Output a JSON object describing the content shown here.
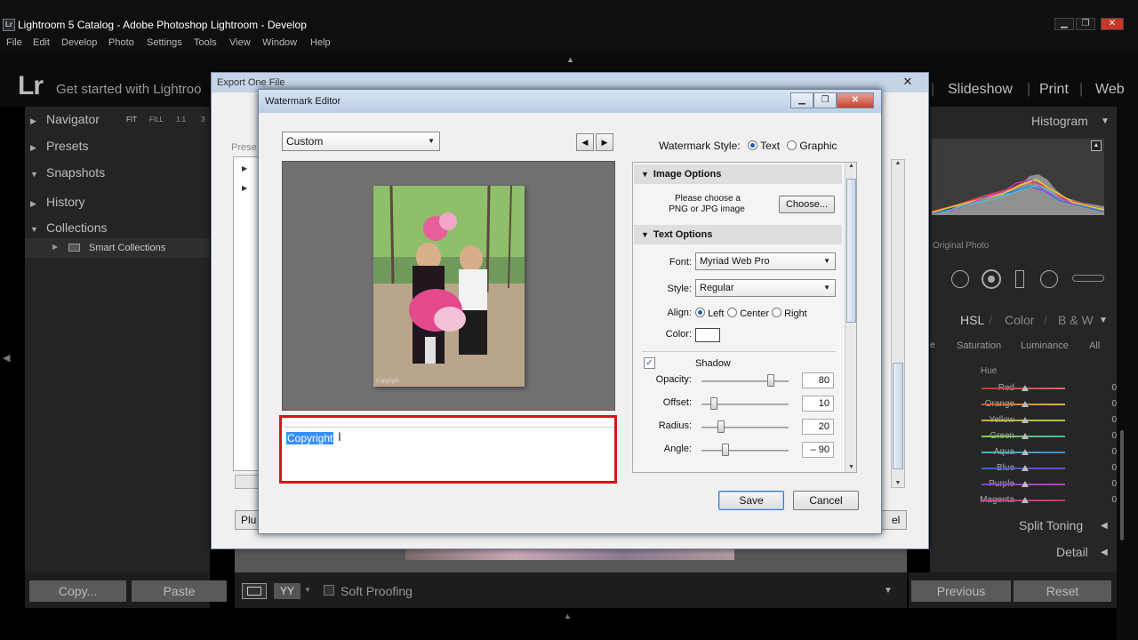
{
  "window": {
    "title": "Lightroom 5 Catalog - Adobe Photoshop Lightroom - Develop",
    "icon": "Lr"
  },
  "menu": [
    "File",
    "Edit",
    "Develop",
    "Photo",
    "Settings",
    "Tools",
    "View",
    "Window",
    "Help"
  ],
  "modulebar": {
    "logo": "Lr",
    "started": "Get started with Lightroo",
    "modules": [
      "Slideshow",
      "Print",
      "Web"
    ]
  },
  "left_panel": {
    "sections": [
      {
        "label": "Navigator",
        "expanded": false
      },
      {
        "label": "Presets",
        "expanded": false
      },
      {
        "label": "Snapshots",
        "expanded": true
      },
      {
        "label": "History",
        "expanded": false
      },
      {
        "label": "Collections",
        "expanded": true
      }
    ],
    "nav_zoom": [
      "FIT",
      "FILL",
      "1:1",
      "3"
    ],
    "smart_collections": "Smart Collections",
    "copy_btn": "Copy...",
    "paste_btn": "Paste"
  },
  "toolbar": {
    "soft_proofing": "Soft Proofing"
  },
  "right_panel": {
    "histogram": "Histogram",
    "original_photo": "Original Photo",
    "hsl_tabs": [
      "HSL",
      "Color",
      "B & W"
    ],
    "hsl_subtabs": [
      "Saturation",
      "Luminance",
      "All"
    ],
    "hue_label": "Hue",
    "hue_rows": [
      {
        "name": "Red",
        "value": "0",
        "color": "#d13c3c"
      },
      {
        "name": "Orange",
        "value": "0",
        "color": "#d98a2c"
      },
      {
        "name": "Yellow",
        "value": "0",
        "color": "#d6c93a"
      },
      {
        "name": "Green",
        "value": "0",
        "color": "#4aa84a"
      },
      {
        "name": "Aqua",
        "value": "0",
        "color": "#3cb0b0"
      },
      {
        "name": "Blue",
        "value": "0",
        "color": "#3a5fd0"
      },
      {
        "name": "Purple",
        "value": "0",
        "color": "#8a4ad0"
      },
      {
        "name": "Magenta",
        "value": "0",
        "color": "#cf3fa8"
      }
    ],
    "split_toning": "Split Toning",
    "detail": "Detail",
    "previous_btn": "Previous",
    "reset_btn": "Reset"
  },
  "export_dialog": {
    "title": "Export One File",
    "preset_label": "Prese",
    "plugin_btn": "Plu",
    "cancel_fragment": "el"
  },
  "watermark_editor": {
    "title": "Watermark Editor",
    "preset": "Custom",
    "style_label": "Watermark Style:",
    "style_options": [
      "Text",
      "Graphic"
    ],
    "style_selected": "Text",
    "image_options": {
      "header": "Image Options",
      "message_line1": "Please choose a",
      "message_line2": "PNG or JPG image",
      "choose_btn": "Choose..."
    },
    "text_options": {
      "header": "Text Options",
      "font_label": "Font:",
      "font_value": "Myriad Web Pro",
      "style_label": "Style:",
      "style_value": "Regular",
      "align_label": "Align:",
      "align_options": [
        "Left",
        "Center",
        "Right"
      ],
      "align_selected": "Left",
      "color_label": "Color:",
      "color_value": "#ffffff"
    },
    "shadow": {
      "label": "Shadow",
      "checked": true,
      "rows": [
        {
          "label": "Opacity:",
          "value": "80",
          "fraction": 0.8
        },
        {
          "label": "Offset:",
          "value": "10",
          "fraction": 0.1
        },
        {
          "label": "Radius:",
          "value": "20",
          "fraction": 0.2
        },
        {
          "label": "Angle:",
          "value": "– 90",
          "fraction": 0.25
        }
      ]
    },
    "preview_watermark": "Copyright",
    "text_input": "Copyright",
    "save_btn": "Save",
    "cancel_btn": "Cancel"
  }
}
